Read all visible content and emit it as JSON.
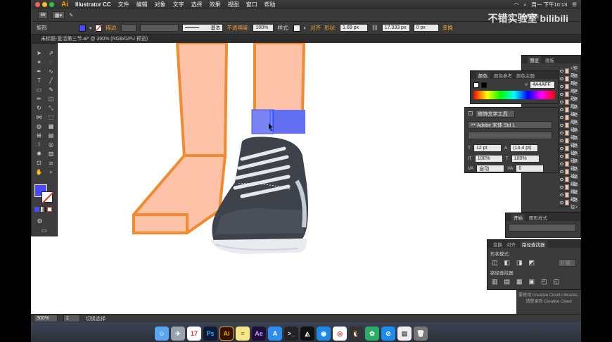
{
  "menubar": {
    "app": "Illustrator CC",
    "items": [
      "文件",
      "编辑",
      "对象",
      "文字",
      "选择",
      "效果",
      "视图",
      "窗口",
      "帮助"
    ],
    "clock": "周一 下午10:13",
    "workspace": "基本功能"
  },
  "watermark": "不错实验室 bilibili",
  "control1": {
    "object_type": "矩形",
    "stroke_label": "描边:",
    "stroke_style": "基本",
    "opacity_label": "不透明度:",
    "opacity_value": "100%",
    "style_label": "样式:",
    "align_label": "对齐",
    "shape_label": "形状:",
    "width_value": "1.69 px",
    "height_value": "17.333 px",
    "corner_value": "0 px",
    "transform_label": "变换"
  },
  "doc_tab": "未标题-复活第三节.ai* @ 300% (RGB/GPU 预览)",
  "status": {
    "zoom": "300%",
    "page": "1",
    "tool": "切换选择"
  },
  "color_panel": {
    "tabs": [
      "颜色",
      "颜色参考",
      "颜色主题"
    ],
    "hex": "4A4AFF"
  },
  "type_panel": {
    "title": "修饰文字工具",
    "font": "Adobe 宋体 Std L",
    "size": "12 pt",
    "leading": "(14.4 pt)",
    "scale_v": "100%",
    "scale_h": "100%",
    "kerning": "自动",
    "tracking": "0"
  },
  "layers_panel": {
    "tabs": [
      "图层",
      "画板"
    ],
    "items": [
      "<矩形>",
      "<矩形>",
      "<矩形>",
      "<矩形>",
      "<矩形>",
      "<路径>",
      "<矩形>",
      "<路径>",
      "<路径>",
      "<路径>",
      "<路径>",
      "<路径>",
      "<路径>",
      "<路径>",
      "<编组>",
      "<编组>",
      "<编组>",
      "<路径>"
    ]
  },
  "align_panel": {
    "tabs": [
      "开始",
      "图形样式"
    ]
  },
  "pathfinder_panel": {
    "tabs": [
      "变换",
      "对齐",
      "路径查找器"
    ],
    "shape_modes": "形状模式:",
    "expand_label": "扩展",
    "pathfinders": "路径查找器:"
  },
  "libraries_msg": [
    "要使用 Creative Cloud Libraries,",
    "请登录到 Creative Cloud"
  ],
  "colors": {
    "fill": "#4a4aff",
    "skin": "#fdc2a8",
    "outline": "#f28b30",
    "shoe": "#3d424b",
    "sock": "#6470f2"
  },
  "dock": [
    "Finder",
    "Launchpad",
    "Calendar",
    "Ps",
    "Ai",
    "Notes",
    "Ae",
    "App Store",
    "Terminal",
    "Unity",
    "QQ Browser",
    "Chrome",
    "QQ",
    "WeChat",
    "Safari",
    "Files",
    "Trash"
  ]
}
